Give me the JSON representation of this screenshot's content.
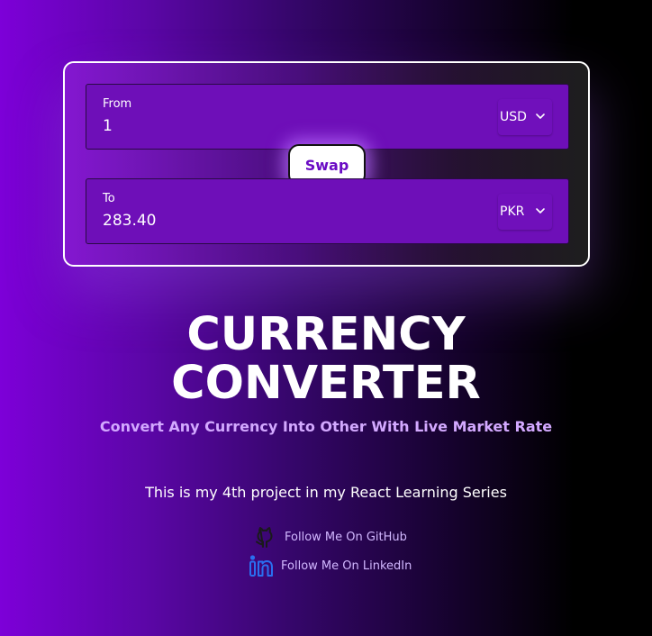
{
  "converter": {
    "from": {
      "label": "From",
      "value": "1",
      "currency": "USD"
    },
    "to": {
      "label": "To",
      "value": "283.40",
      "currency": "PKR"
    },
    "swap_label": "Swap"
  },
  "hero": {
    "title_line1": "CURRENCY",
    "title_line2": "CONVERTER",
    "subtitle": "Convert Any Currency Into Other With Live Market Rate",
    "description": "This is my 4th project in my React Learning Series"
  },
  "links": {
    "github": {
      "label": "Follow Me On GitHub",
      "icon": "github-icon"
    },
    "linkedin": {
      "label": "Follow Me On LinkedIn",
      "icon": "linkedin-icon"
    }
  },
  "colors": {
    "accent": "#6a0bc4",
    "field_bg": "#6e0fb8",
    "subtitle": "#d3a9ff",
    "linkedin_blue": "#2a6ff0"
  }
}
